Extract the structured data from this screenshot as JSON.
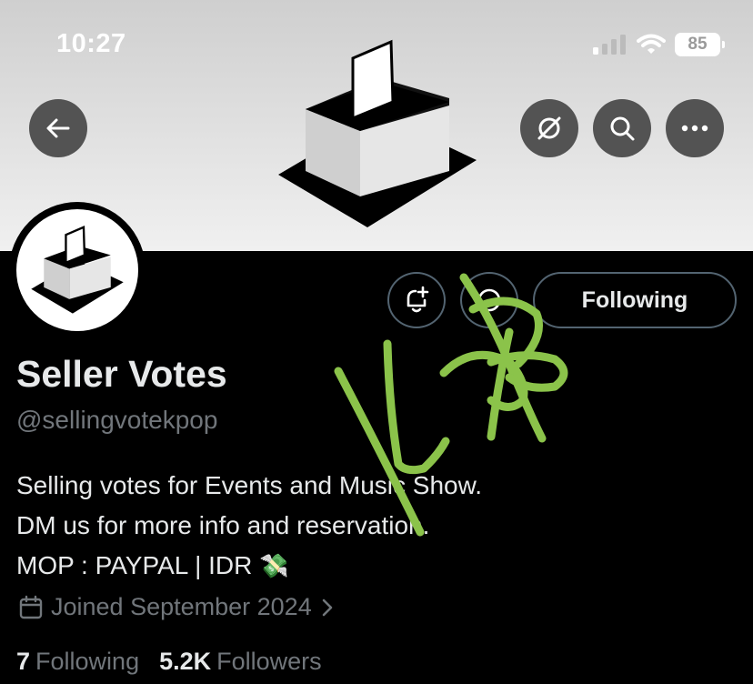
{
  "status_bar": {
    "time": "10:27",
    "battery": "85",
    "icons": [
      "cellular-signal-icon",
      "wifi-icon",
      "battery-icon"
    ]
  },
  "nav": {
    "back_icon": "arrow-left-icon",
    "grok_icon": "grok-icon",
    "search_icon": "search-icon",
    "more_icon": "more-horizontal-icon"
  },
  "profile": {
    "name": "Seller Votes",
    "handle": "@sellingvotekpop",
    "bio": [
      "Selling votes for Events and Music Show.",
      "DM us for more info and reservation.",
      "MOP : PAYPAL | IDR"
    ],
    "bio_emoji": "💸",
    "joined": "Joined September 2024",
    "following_count": "7",
    "following_label": "Following",
    "followers_count": "5.2K",
    "followers_label": "Followers"
  },
  "actions": {
    "follow_label": "Following",
    "notify_icon": "bell-plus-icon",
    "grok_icon": "grok-icon"
  },
  "colors": {
    "background": "#000000",
    "primary_text": "#e7e9ea",
    "secondary_text": "#71767b",
    "button_border": "#536471",
    "scribble": "#8bc34a"
  }
}
